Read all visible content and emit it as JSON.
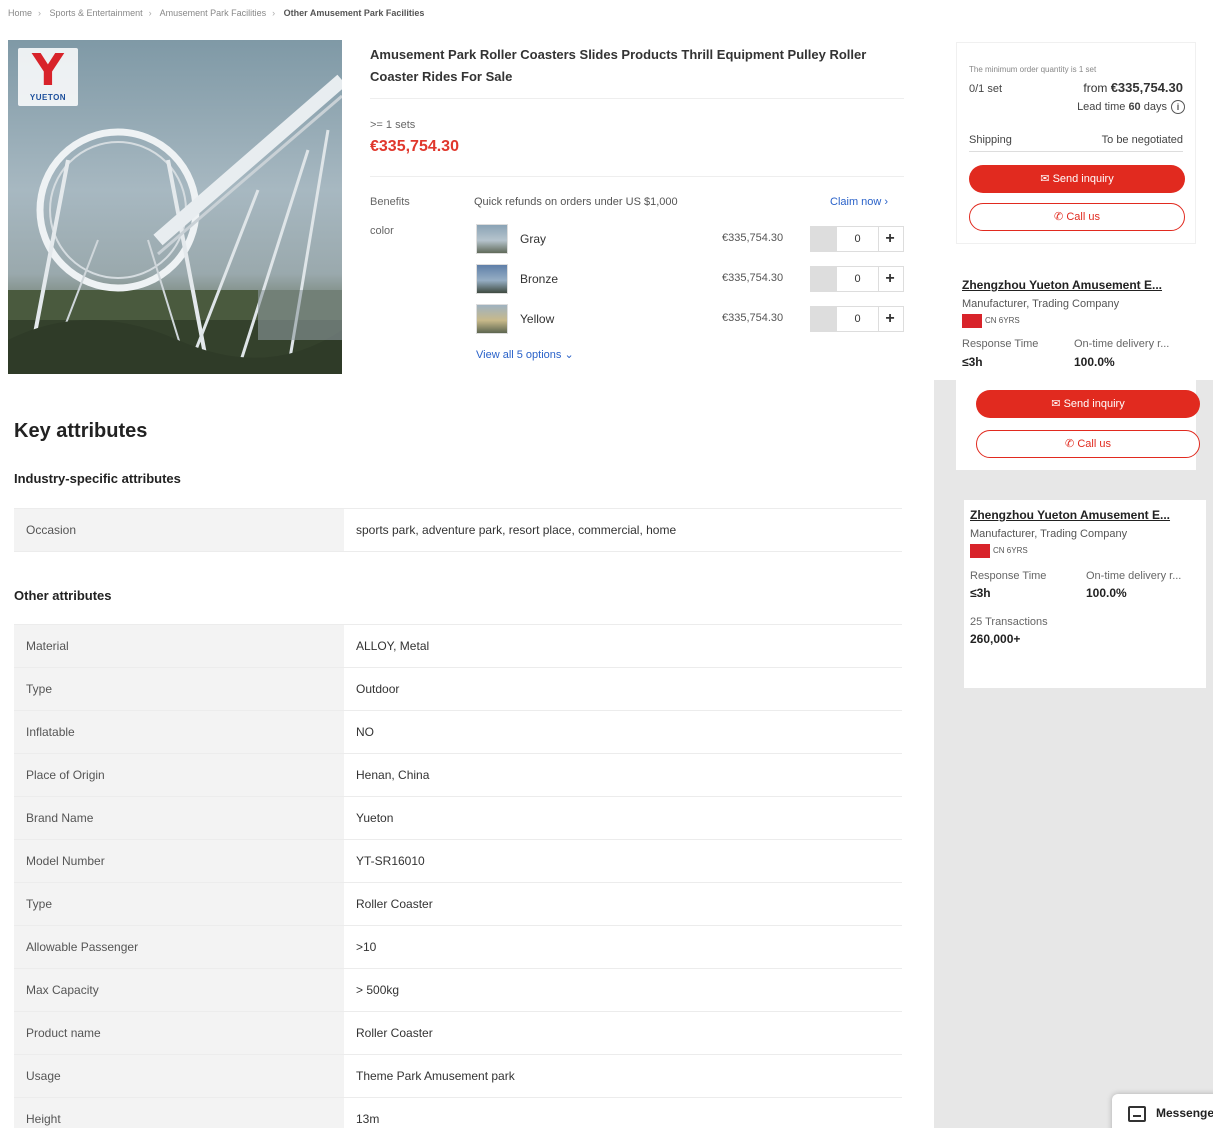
{
  "breadcrumb": [
    {
      "label": "Home"
    },
    {
      "label": "Sports & Entertainment"
    },
    {
      "label": "Amusement Park Facilities"
    },
    {
      "label": "Other Amusement Park Facilities"
    }
  ],
  "product": {
    "title": "Amusement Park Roller Coasters Slides Products Thrill Equipment Pulley Roller Coaster Rides For Sale",
    "moq": ">= 1 sets",
    "price": "€335,754.30",
    "image_logo_letter": "Y",
    "image_logo_text": "YUETON"
  },
  "benefits": {
    "label": "Benefits",
    "text": "Quick refunds on orders under US $1,000",
    "claim_label": "Claim now"
  },
  "color": {
    "label": "color",
    "options": [
      {
        "name": "Gray",
        "price": "€335,754.30",
        "qty": "0"
      },
      {
        "name": "Bronze",
        "price": "€335,754.30",
        "qty": "0"
      },
      {
        "name": "Yellow",
        "price": "€335,754.30",
        "qty": "0"
      }
    ],
    "view_all": "View all 5 options"
  },
  "order": {
    "min_note": "The minimum order quantity is 1 set",
    "unit": "0/1 set",
    "from_label": "from",
    "from_price": "€335,754.30",
    "lead_label": "Lead time",
    "lead_value": "60",
    "lead_unit": "days",
    "shipping_label": "Shipping",
    "shipping_value": "To be negotiated",
    "send_inquiry": "Send inquiry",
    "call_us": "Call us"
  },
  "supplier": {
    "name": "Zhengzhou Yueton Amusement E...",
    "type": "Manufacturer, Trading Company",
    "country": "CN",
    "years": "6YRS",
    "response_label": "Response Time",
    "response_value": "≤3h",
    "delivery_label": "On-time delivery r...",
    "delivery_value": "100.0%",
    "transactions_label": "25 Transactions",
    "transactions_value": "260,000+"
  },
  "attributes": {
    "title": "Key attributes",
    "industry_heading": "Industry-specific attributes",
    "industry": [
      {
        "k": "Occasion",
        "v": "sports park, adventure park, resort place, commercial, home"
      }
    ],
    "other_heading": "Other attributes",
    "other": [
      {
        "k": "Material",
        "v": "ALLOY, Metal"
      },
      {
        "k": "Type",
        "v": "Outdoor"
      },
      {
        "k": "Inflatable",
        "v": "NO"
      },
      {
        "k": "Place of Origin",
        "v": "Henan, China"
      },
      {
        "k": "Brand Name",
        "v": "Yueton"
      },
      {
        "k": "Model Number",
        "v": "YT-SR16010"
      },
      {
        "k": "Type",
        "v": "Roller Coaster"
      },
      {
        "k": "Allowable Passenger",
        "v": ">10"
      },
      {
        "k": "Max Capacity",
        "v": "> 500kg"
      },
      {
        "k": "Product name",
        "v": "Roller Coaster"
      },
      {
        "k": "Usage",
        "v": "Theme Park Amusement park"
      },
      {
        "k": "Height",
        "v": "13m"
      }
    ]
  },
  "messenger": {
    "label": "Messenger"
  }
}
